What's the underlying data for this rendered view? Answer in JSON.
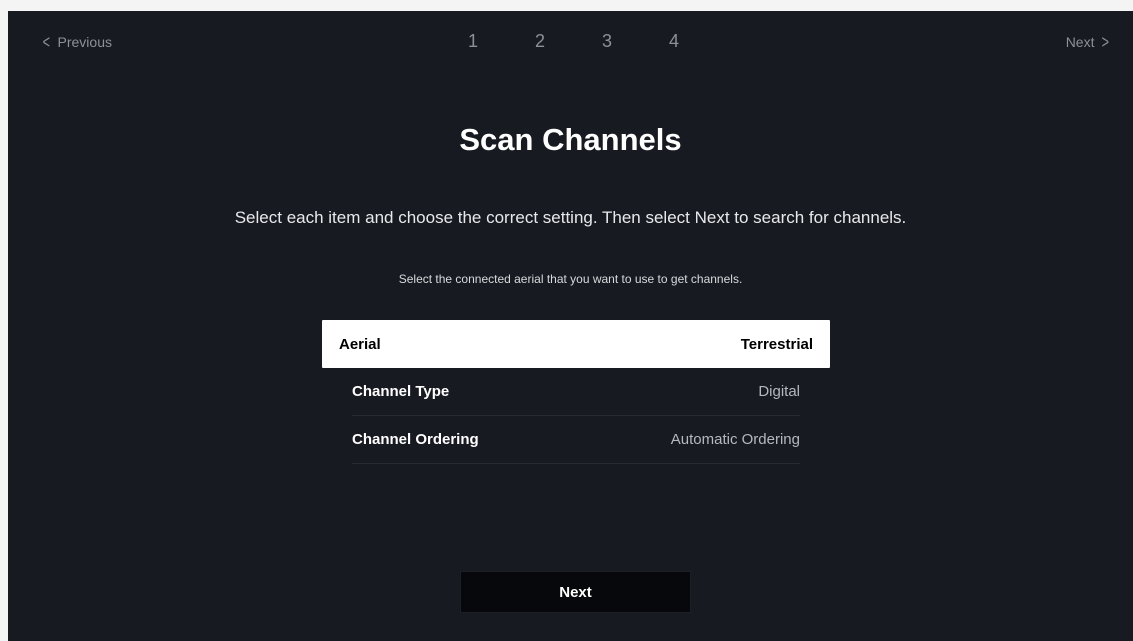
{
  "nav": {
    "previous_label": "Previous",
    "next_label": "Next",
    "previous_icon": "chevron-left-icon",
    "next_icon": "chevron-right-icon",
    "prev_glyph": "<",
    "next_glyph": ">"
  },
  "steps": [
    "1",
    "2",
    "3",
    "4"
  ],
  "title": "Scan Channels",
  "instruction": "Select each item and choose the correct setting. Then select Next to search for channels.",
  "hint": "Select the connected aerial that you want to use to get channels.",
  "settings": [
    {
      "label": "Aerial",
      "value": "Terrestrial",
      "focused": true
    },
    {
      "label": "Channel Type",
      "value": "Digital",
      "focused": false
    },
    {
      "label": "Channel Ordering",
      "value": "Automatic Ordering",
      "focused": false
    }
  ],
  "next_button_label": "Next",
  "colors": {
    "background": "#171a21",
    "focus_highlight": "#ffffff",
    "button_background": "#07080b",
    "muted_text": "#8c9099"
  }
}
